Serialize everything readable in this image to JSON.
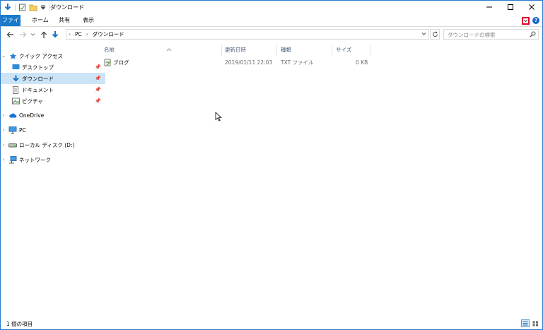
{
  "window": {
    "title": "ダウンロード"
  },
  "ribbon": {
    "tabs": [
      "ファイル",
      "ホーム",
      "共有",
      "表示"
    ]
  },
  "address_bar": {
    "crumbs": [
      "PC",
      "ダウンロード"
    ],
    "search_placeholder": "ダウンロードの検索"
  },
  "sidebar": {
    "quick_access": "クイック アクセス",
    "items": [
      {
        "label": "デスクトップ",
        "icon": "desktop-icon",
        "pinned": true
      },
      {
        "label": "ダウンロード",
        "icon": "download-icon",
        "pinned": true,
        "selected": true
      },
      {
        "label": "ドキュメント",
        "icon": "document-icon",
        "pinned": true
      },
      {
        "label": "ピクチャ",
        "icon": "picture-icon",
        "pinned": true
      }
    ],
    "onedrive": "OneDrive",
    "pc": "PC",
    "local_disk": "ローカル ディスク (D:)",
    "network": "ネットワーク"
  },
  "file_list": {
    "columns": [
      "名前",
      "更新日時",
      "種類",
      "サイズ"
    ],
    "rows": [
      {
        "name": "ブログ",
        "modified": "2019/01/11 22:03",
        "type": "TXT ファイル",
        "size": "0 KB"
      }
    ]
  },
  "status_bar": {
    "item_count": "1 個の項目"
  },
  "colors": {
    "accent": "#1979ca",
    "selection": "#cce4f7",
    "highlight_box": "#e0002a"
  }
}
